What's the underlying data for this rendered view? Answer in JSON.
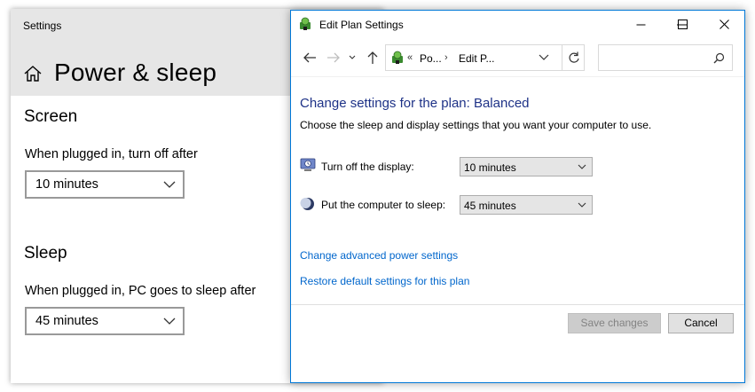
{
  "settings": {
    "app_title": "Settings",
    "page_title": "Power & sleep",
    "screen": {
      "section_title": "Screen",
      "label": "When plugged in, turn off after",
      "value": "10 minutes"
    },
    "sleep": {
      "section_title": "Sleep",
      "label": "When plugged in, PC goes to sleep after",
      "value": "45 minutes"
    }
  },
  "edit_plan": {
    "window_title": "Edit Plan Settings",
    "address": {
      "overflow": "«",
      "crumb1": "Po...",
      "separator": "›",
      "crumb2": "Edit P..."
    },
    "search": {
      "placeholder": ""
    },
    "heading": "Change settings for the plan: Balanced",
    "description": "Choose the sleep and display settings that you want your computer to use.",
    "display": {
      "label": "Turn off the display:",
      "value": "10 minutes"
    },
    "sleep": {
      "label": "Put the computer to sleep:",
      "value": "45 minutes"
    },
    "links": {
      "advanced": "Change advanced power settings",
      "restore": "Restore default settings for this plan"
    },
    "buttons": {
      "save": "Save changes",
      "cancel": "Cancel"
    }
  },
  "colors": {
    "window_border": "#0078d7",
    "heading": "#1e3287",
    "link": "#0066cc",
    "settings_header": "#e6e6e6"
  },
  "icons": [
    "home-icon",
    "chevron-down-icon",
    "power-plan-icon",
    "back-arrow-icon",
    "forward-arrow-icon",
    "up-arrow-icon",
    "refresh-icon",
    "search-icon",
    "minimize-icon",
    "maximize-icon",
    "close-icon",
    "display-icon",
    "sleep-moon-icon"
  ]
}
